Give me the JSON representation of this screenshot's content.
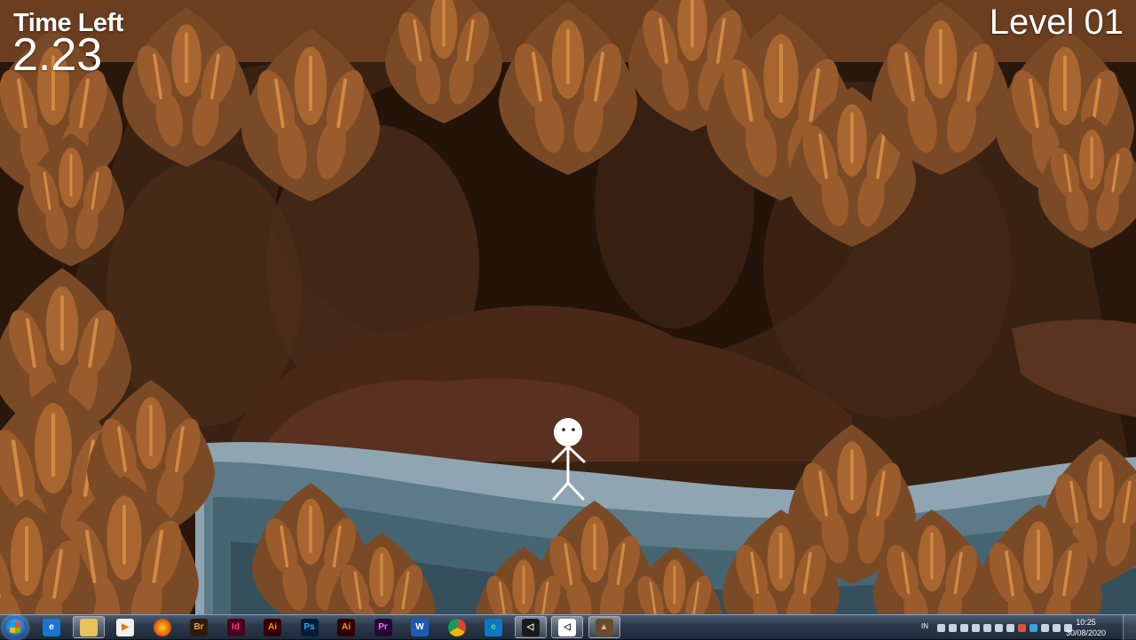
{
  "hud": {
    "time_label": "Time Left",
    "time_value": "2.23",
    "level_label": "Level 01"
  },
  "scene": {
    "character": "stick-figure",
    "environment": "cave with underground stream"
  },
  "taskbar": {
    "language": "IN",
    "time": "10:25",
    "date": "30/08/2020",
    "apps": [
      {
        "name": "internet-explorer",
        "glyph": "e",
        "bg": "#1b74d1",
        "fg": "#ffffff"
      },
      {
        "name": "file-explorer",
        "glyph": "",
        "bg": "#e8c25a",
        "fg": "#000000"
      },
      {
        "name": "media-player",
        "glyph": "▶",
        "bg": "#f1f1f1",
        "fg": "#e07b00"
      },
      {
        "name": "firefox",
        "glyph": "",
        "bg": "#e66000",
        "fg": "#ffffff"
      },
      {
        "name": "adobe-bridge",
        "glyph": "Br",
        "bg": "#2d1a0a",
        "fg": "#e8a23c"
      },
      {
        "name": "adobe-indesign",
        "glyph": "Id",
        "bg": "#49021f",
        "fg": "#ff3f8b"
      },
      {
        "name": "adobe-illustrator-pinned",
        "glyph": "Ai",
        "bg": "#330000",
        "fg": "#ff9a00"
      },
      {
        "name": "adobe-photoshop",
        "glyph": "Ps",
        "bg": "#001e36",
        "fg": "#31a8ff"
      },
      {
        "name": "adobe-illustrator",
        "glyph": "Ai",
        "bg": "#330000",
        "fg": "#ff9a00"
      },
      {
        "name": "adobe-premiere",
        "glyph": "Pr",
        "bg": "#2a0634",
        "fg": "#ea77ff"
      },
      {
        "name": "microsoft-word",
        "glyph": "W",
        "bg": "#1e5bb8",
        "fg": "#ffffff"
      },
      {
        "name": "google-chrome",
        "glyph": "",
        "bg": "#ffffff",
        "fg": "#000000"
      },
      {
        "name": "microsoft-edge",
        "glyph": "e",
        "bg": "#0c77c7",
        "fg": "#5fe06a"
      },
      {
        "name": "unity-hub",
        "glyph": "◁",
        "bg": "#1a1a1a",
        "fg": "#ffffff"
      },
      {
        "name": "unity-editor",
        "glyph": "◁",
        "bg": "#ffffff",
        "fg": "#222222"
      },
      {
        "name": "game-window",
        "glyph": "▲",
        "bg": "#6b4a2e",
        "fg": "#d9b48a"
      }
    ]
  }
}
